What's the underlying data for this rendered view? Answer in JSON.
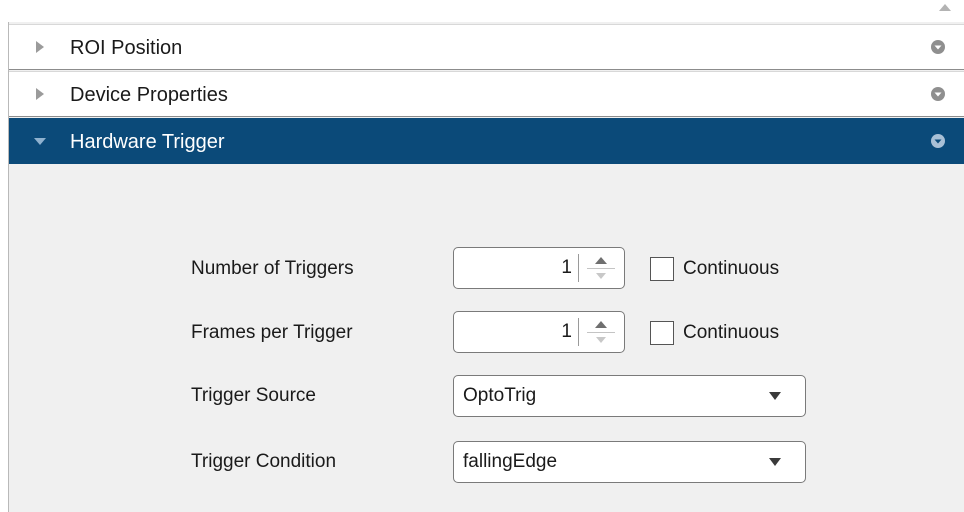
{
  "sections": [
    {
      "label": "ROI Position",
      "expanded": false
    },
    {
      "label": "Device Properties",
      "expanded": false
    },
    {
      "label": "Hardware Trigger",
      "expanded": true
    }
  ],
  "hardware_trigger": {
    "number_of_triggers": {
      "label": "Number of Triggers",
      "value": "1",
      "continuous_label": "Continuous",
      "continuous_checked": false
    },
    "frames_per_trigger": {
      "label": "Frames per Trigger",
      "value": "1",
      "continuous_label": "Continuous",
      "continuous_checked": false
    },
    "trigger_source": {
      "label": "Trigger Source",
      "value": "OptoTrig"
    },
    "trigger_condition": {
      "label": "Trigger Condition",
      "value": "fallingEdge"
    }
  },
  "colors": {
    "active_header": "#0b4a79",
    "panel_background": "#f0f0f0",
    "header_background": "#ffffff"
  },
  "icons": {
    "collapsed": "triangle-right-icon",
    "expanded": "triangle-down-icon",
    "section_menu": "circle-chevron-down-icon",
    "spinner_up": "spin-up-arrow-icon",
    "spinner_down": "spin-down-arrow-icon",
    "dropdown": "caret-down-icon",
    "scroll_up": "scroll-up-arrow-icon"
  }
}
